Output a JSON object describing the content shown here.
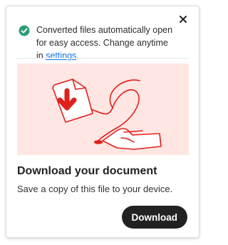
{
  "notice": {
    "text": "Converted files automatically open for easy access. Change anytime in ",
    "link_text": "settings",
    "after_link": ".",
    "icon": "check-circle-icon"
  },
  "close_icon": "close-icon",
  "content": {
    "title": "Download your document",
    "subtitle": "Save a copy of this file to your device."
  },
  "download_button": {
    "label": "Download"
  },
  "colors": {
    "accent_red": "#e0201b",
    "success_green": "#2d9d78",
    "hero_bg": "#ffe6e3",
    "link_blue": "#1473e6",
    "button_bg": "#222222"
  }
}
